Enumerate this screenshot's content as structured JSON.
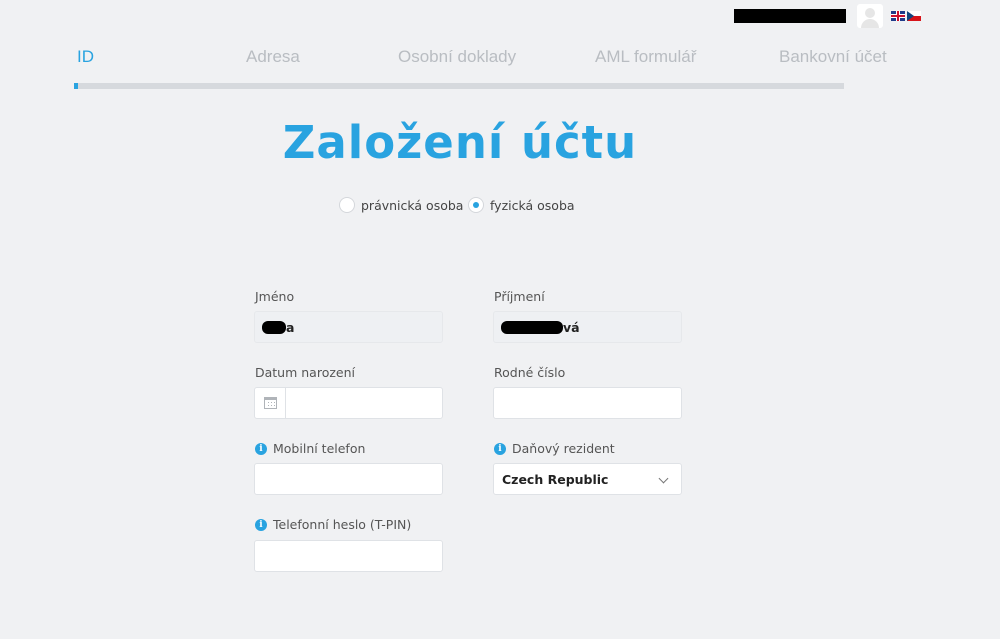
{
  "header": {
    "user_name_redacted": true,
    "languages": [
      "English",
      "Čeština"
    ]
  },
  "steps": [
    {
      "label": "ID",
      "active": true
    },
    {
      "label": "Adresa",
      "active": false
    },
    {
      "label": "Osobní doklady",
      "active": false
    },
    {
      "label": "AML formulář",
      "active": false
    },
    {
      "label": "Bankovní účet",
      "active": false
    }
  ],
  "progress": 0.005,
  "title": "Založení účtu",
  "entity_type": {
    "options": [
      "právnická osoba",
      "fyzická osoba"
    ],
    "selected": "fyzická osoba"
  },
  "form": {
    "first_name": {
      "label": "Jméno",
      "value_visible_end": "a"
    },
    "last_name": {
      "label": "Příjmení",
      "value_visible_end": "vá"
    },
    "birth_date": {
      "label": "Datum narození",
      "value": ""
    },
    "birth_number": {
      "label": "Rodné číslo",
      "value": ""
    },
    "mobile_phone": {
      "label": "Mobilní telefon",
      "value": ""
    },
    "tax_resident": {
      "label": "Daňový rezident",
      "value": "Czech Republic"
    },
    "phone_password": {
      "label": "Telefonní heslo (T-PIN)",
      "value": ""
    }
  },
  "colors": {
    "accent": "#29a3e0",
    "background": "#f0f1f3",
    "muted_text": "#b9bdc2"
  }
}
